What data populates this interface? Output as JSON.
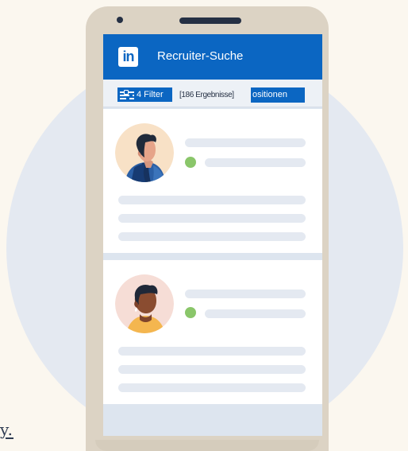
{
  "header": {
    "logo_text": "in",
    "title": "Recruiter-Suche"
  },
  "toolbar": {
    "filter_label": "4 Filter",
    "results_label": "[186 Ergebnisse]",
    "positions_label": "ositionen"
  },
  "background_text": "y.",
  "icons": {
    "logo": "linkedin-icon",
    "filter": "filter-sliders-icon",
    "online_status": "green-status-dot-icon"
  },
  "colors": {
    "page_background": "#fbf7ef",
    "background_circle": "#e4e9f1",
    "phone_frame": "#dcd3c4",
    "brand_blue": "#0b66c2",
    "card_placeholder": "#e4e9f1",
    "status_green": "#8ac66a",
    "avatar_one_background": "#f8e1c6",
    "avatar_two_background": "#f6ddd6"
  },
  "candidates": [
    {
      "avatar": "man-in-blue-jacket-avatar",
      "status": "online"
    },
    {
      "avatar": "man-in-yellow-shirt-avatar",
      "status": "online"
    }
  ]
}
